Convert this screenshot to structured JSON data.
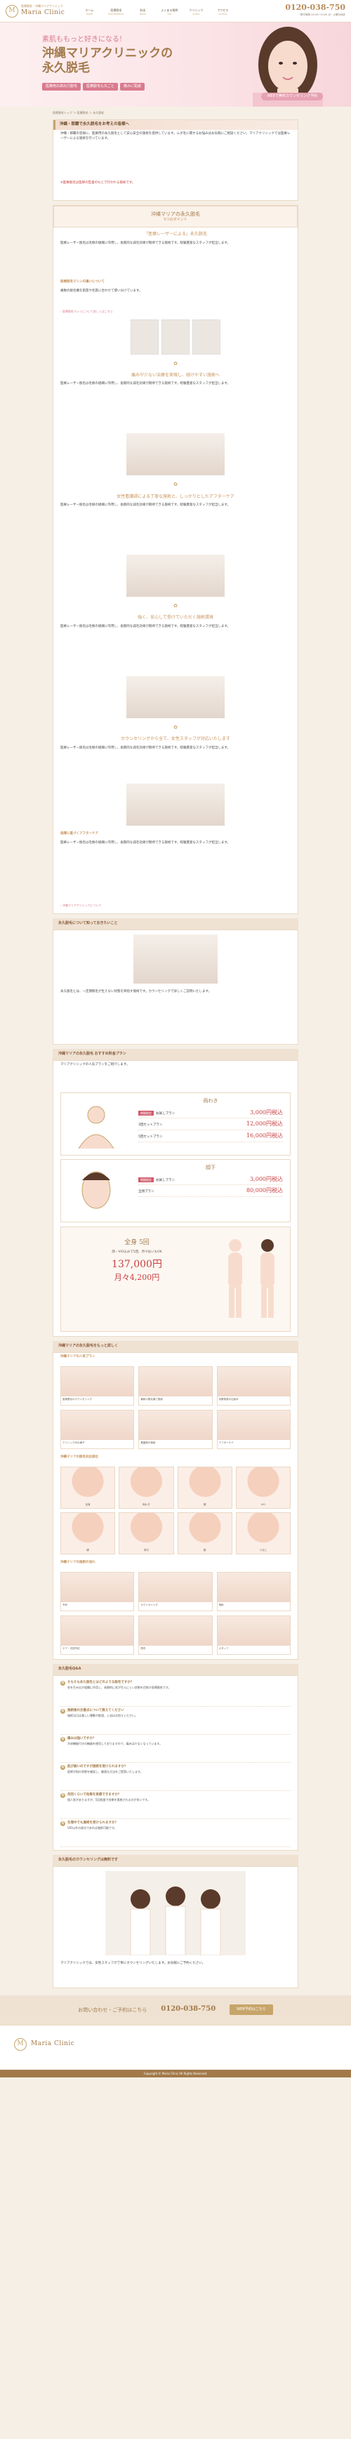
{
  "header": {
    "logo_mark": "M",
    "logo_tag": "医療脱毛・沖縄マリアクリニック",
    "logo_name": "Maria Clinic",
    "nav": [
      {
        "jp": "ホーム",
        "en": "HOME"
      },
      {
        "jp": "医療脱毛",
        "en": "HAIR REMOVAL"
      },
      {
        "jp": "料金",
        "en": "PRICE"
      },
      {
        "jp": "よくある質問",
        "en": "FAQ"
      },
      {
        "jp": "クリニック",
        "en": "CLINIC"
      },
      {
        "jp": "アクセス",
        "en": "ACCESS"
      }
    ],
    "tel": "0120-038-750",
    "tel_sub": "受付時間 10:00〜19:00 月・火曜日休診"
  },
  "hero": {
    "catch": "素肌ももっと好きになる!",
    "title_line1": "沖縄マリアクリニックの",
    "title_line2": "永久脱毛",
    "badges": [
      "医療用の高出力脱毛",
      "医療脱毛も丸ごと",
      "痛みに配慮"
    ],
    "cta": "WEBで無料カウンセリング予約"
  },
  "breadcrumb": "医療脱毛トップ ＞ 医療脱毛 ＞ 永久脱毛",
  "section1": {
    "heading": "沖縄・那覇で永久脱毛をお考えの皆様へ",
    "text": "沖縄・那覇の皆様に、医療用の永久脱毛として安心安全の施術を提供しています。ムダ毛に関するお悩みはお気軽にご相談ください。マリアクリニックでは医療レーザーによる施術を行っています。",
    "note": "※医療脱毛は医師の監督のもとで行われる施術です。"
  },
  "section2": {
    "heading_jp": "沖縄マリアの永久脱毛",
    "heading_sub": "5つのポイント",
    "point_lead": "「医療レーザーによる」永久脱毛",
    "text": "医療レーザー脱毛は毛根の組織に作用し、長期的な減毛効果が期待できる施術です。経験豊富なスタッフが担当します。",
    "sub_heading": "医療脱毛マシンの違いについて",
    "machine_text": "複数の脱毛機を肌質や毛質に合わせて使い分けています。",
    "link": "› 医療脱毛マシンについて詳しくはこちら",
    "point2": "痛みが少ない治療を実現し、続けやすい施術へ",
    "point3": "女性看護師による丁寧な施術と、しっかりとしたアフターケア",
    "point4": "強く、安心して受けていただく施術環境",
    "point5": "カウンセリングから全て、女性スタッフが対応いたします",
    "link2": "› 沖縄マリアクリニックについて",
    "faq_point": "指導に基づくアフターケア"
  },
  "section3": {
    "heading": "永久脱毛について知っておきたいこと",
    "text": "永久脱毛とは、一定期間毛が生えない状態を目指す施術です。カウンセリングで詳しくご説明いたします。"
  },
  "price": {
    "heading": "沖縄マリアの永久脱毛",
    "heading2": "おすすめ料金プラン",
    "text": "マリアクリニックの人気プランをご紹介します。",
    "plans": [
      {
        "name": "両わき",
        "tag": "期間限定",
        "rows": [
          {
            "label": "お試しプラン",
            "value": "3,000円税込"
          },
          {
            "label": "3回セットプラン",
            "value": "12,000円税込"
          },
          {
            "label": "5回セットプラン",
            "value": "16,000円税込"
          }
        ]
      },
      {
        "name": "顔下",
        "tag": "期間限定",
        "rows": [
          {
            "label": "お試しプラン",
            "value": "3,000円税込"
          },
          {
            "label": "全顔プラン",
            "value": "80,000円税込"
          }
        ]
      }
    ],
    "full_title": "全身 5回",
    "full_sub": "顔・VIO込みで5回、月々払いもOK",
    "full_price": "137,000円",
    "full_monthly": "月々4,200円"
  },
  "details": {
    "heading": "沖縄マリアの永久脱毛をもっと詳しく",
    "sub1": "沖縄マリアの人気プラン",
    "items1": [
      "医療脱毛のカウンセリング",
      "最新の脱毛機で施術",
      "効果実感の仕組み",
      "クリニック内の様子",
      "看護師が施術",
      "アフターケア"
    ],
    "sub2": "沖縄マリアの脱毛対応部位",
    "parts": [
      "全身",
      "両わき",
      "顔",
      "VIO",
      "脚",
      "背中",
      "腕",
      "うなじ"
    ],
    "sub3": "沖縄マリアの施術の流れ",
    "flow": [
      "予約",
      "カウンセリング",
      "施術",
      "ケア・次回予約",
      "院内",
      "スタッフ"
    ]
  },
  "faq": {
    "heading": "永久脱毛Q&A",
    "items": [
      {
        "q": "そもそも永久脱毛とはどのような脱毛ですか？",
        "a": "毛を生み出す組織に作用し、長期的に毛が生えにくい状態を目指す医療脱毛です。"
      },
      {
        "q": "施術後の注意点について教えてください",
        "a": "施術当日は激しい運動や飲酒、入浴はお控えください。"
      },
      {
        "q": "痛みは強いですか？",
        "a": "冷却機能付きの機器を使用しておりますので、痛みは少なくなっています。"
      },
      {
        "q": "肌が弱いのですが施術を受けられますか？",
        "a": "医師が肌の状態を確認し、最適な方法をご提案いたします。"
      },
      {
        "q": "何回くらいで効果を実感できますか？",
        "a": "個人差がありますが、5回程度で効果を実感される方が多いです。"
      },
      {
        "q": "生理中でも施術を受けられますか？",
        "a": "VIO以外の部位であれば施術可能です。"
      }
    ]
  },
  "staff": {
    "heading": "永久脱毛のカウンセリングは無料です",
    "text": "マリアクリニックでは、女性スタッフが丁寧にカウンセリングいたします。お気軽にご予約ください。"
  },
  "footer": {
    "cta_label": "お問い合わせ・ご予約はこちら",
    "tel": "0120-038-750",
    "web_btn": "WEB予約はこちら",
    "logo_name": "Maria Clinic",
    "copyright": "Copyright © Maria Clinic All Rights Reserved."
  }
}
